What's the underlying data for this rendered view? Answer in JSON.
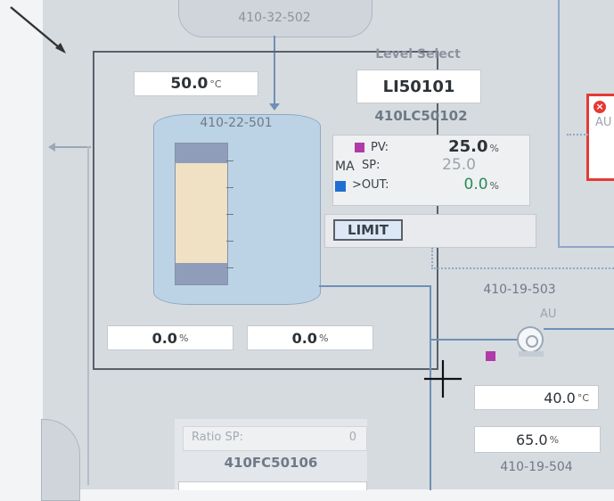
{
  "vessel_top": {
    "tag": "410-32-502"
  },
  "level_select": {
    "title": "Level Select",
    "selected": "LI50101"
  },
  "controller": {
    "tag": "410LC50102",
    "mode": "MA",
    "pv_label": "PV:",
    "pv_value": "25.0",
    "pv_unit": "%",
    "sp_label": "SP:",
    "sp_value": "25.0",
    "out_label": ">OUT:",
    "out_value": "0.0",
    "out_unit": "%",
    "limit_label": "LIMIT"
  },
  "tank": {
    "tag": "410-22-501",
    "temperature": "50.0",
    "temperature_unit": "°C",
    "level_left": "0.0",
    "level_left_unit": "%",
    "level_right": "0.0",
    "level_right_unit": "%"
  },
  "alarm_panel": {
    "text": "AU"
  },
  "pump": {
    "tag": "410-19-503",
    "mode": "AU"
  },
  "right_values": {
    "temp": "40.0",
    "temp_unit": "°C",
    "pct": "65.0",
    "pct_unit": "%",
    "tag": "410-19-504"
  },
  "ratio": {
    "label": "Ratio SP:",
    "value": "0",
    "tag": "410FC50106"
  },
  "colors": {
    "pipe": "#6f90b5",
    "alarm": "#e53935",
    "status_magenta": "#b03aa8",
    "status_blue": "#1f6fd1",
    "out_green": "#2a8a58"
  }
}
